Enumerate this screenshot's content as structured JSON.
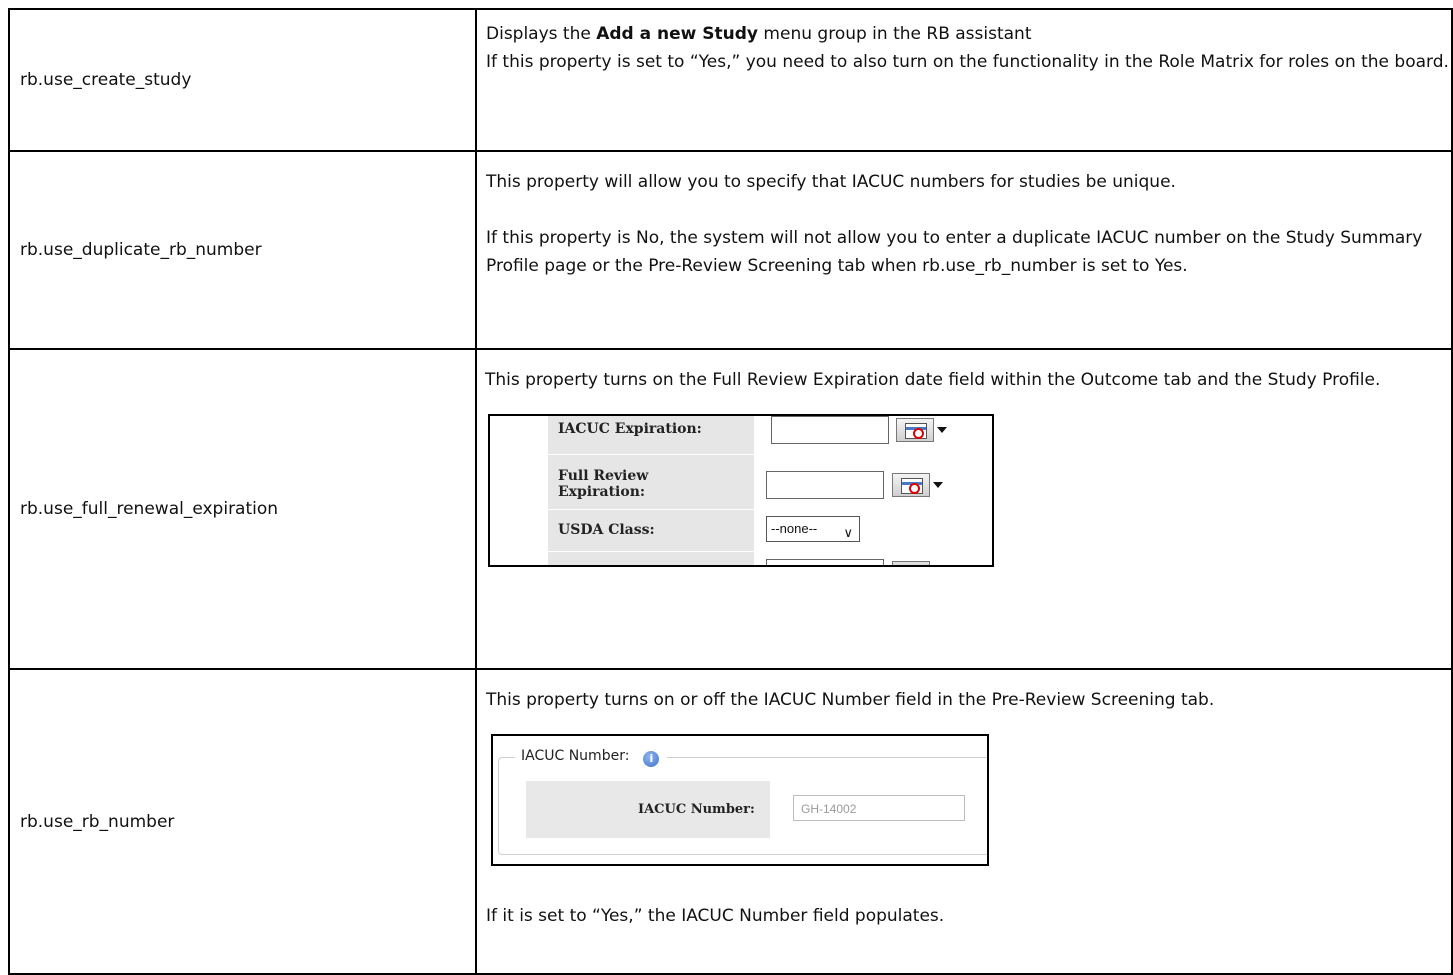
{
  "rows": [
    {
      "property": "rb.use_create_study",
      "desc": {
        "l1_pre": "Displays the ",
        "l1_bold": "Add a new Study",
        "l1_post": " menu group in the RB assistant",
        "l2": "If this property is set to “Yes,” you need to also turn on the functionality in the Role Matrix for roles on the board."
      }
    },
    {
      "property": "rb.use_duplicate_rb_number",
      "desc": {
        "p1": "This property will allow you to specify that IACUC numbers for studies be unique.",
        "p2": "If this property is No, the system will not allow you to enter a duplicate IACUC number on the Study Summary Profile page or the Pre-Review Screening tab when rb.use_rb_number is set to Yes."
      }
    },
    {
      "property": "rb.use_full_renewal_expiration",
      "desc": {
        "p1": "This property turns on the Full Review Expiration date field within the Outcome tab and the Study Profile."
      },
      "screenshot": {
        "label_iacuc_exp": "IACUC Expiration:",
        "label_full_review_1": "Full Review",
        "label_full_review_2": "Expiration:",
        "label_usda": "USDA Class:",
        "usda_value": "--none--"
      }
    },
    {
      "property": "rb.use_rb_number",
      "desc": {
        "p1": "This property turns on or off the IACUC Number field in the Pre-Review Screening tab.",
        "p2": "If it is set to “Yes,” the IACUC Number field populates."
      },
      "screenshot": {
        "legend": "IACUC Number:",
        "info_glyph": "i",
        "label": "IACUC Number:",
        "value": "GH-14002"
      }
    }
  ]
}
